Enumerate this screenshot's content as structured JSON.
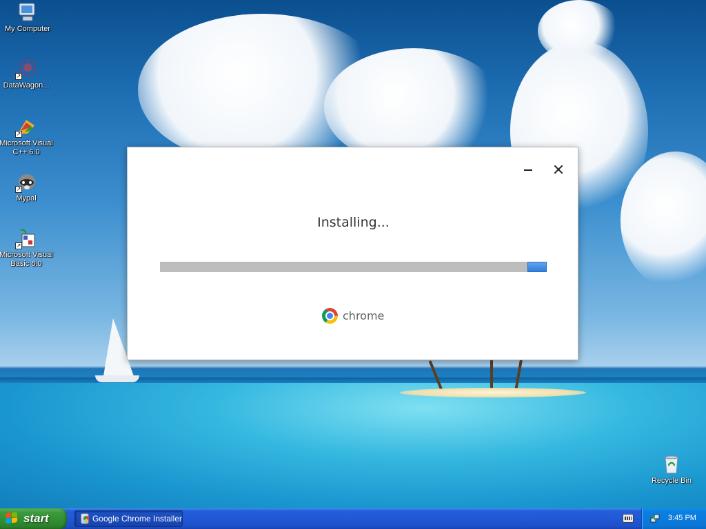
{
  "desktop": {
    "icons": [
      {
        "label": "My Computer",
        "icon": "my-computer-icon"
      },
      {
        "label": "DataWagon...",
        "icon": "datawagon-icon"
      },
      {
        "label": "Microsoft Visual C++ 6.0",
        "icon": "visual-cpp-icon"
      },
      {
        "label": "Mypal",
        "icon": "mypal-raccoon-icon"
      },
      {
        "label": "Microsoft Visual Basic 6.0",
        "icon": "visual-basic-icon"
      },
      {
        "label": "Recycle Bin",
        "icon": "recycle-bin-icon"
      }
    ]
  },
  "installer": {
    "status_text": "Installing...",
    "progress_fraction": 0.05,
    "brand_text": "chrome",
    "minimize_icon": "minimize-icon",
    "close_icon": "close-icon",
    "accent_color": "#3a88e4"
  },
  "taskbar": {
    "start_label": "start",
    "task_items": [
      {
        "label": "Google Chrome Installer",
        "icon": "chrome-installer-icon"
      }
    ],
    "tray_icons": [
      "keyboard-icon",
      "network-icon"
    ],
    "clock": "3:45 PM"
  }
}
